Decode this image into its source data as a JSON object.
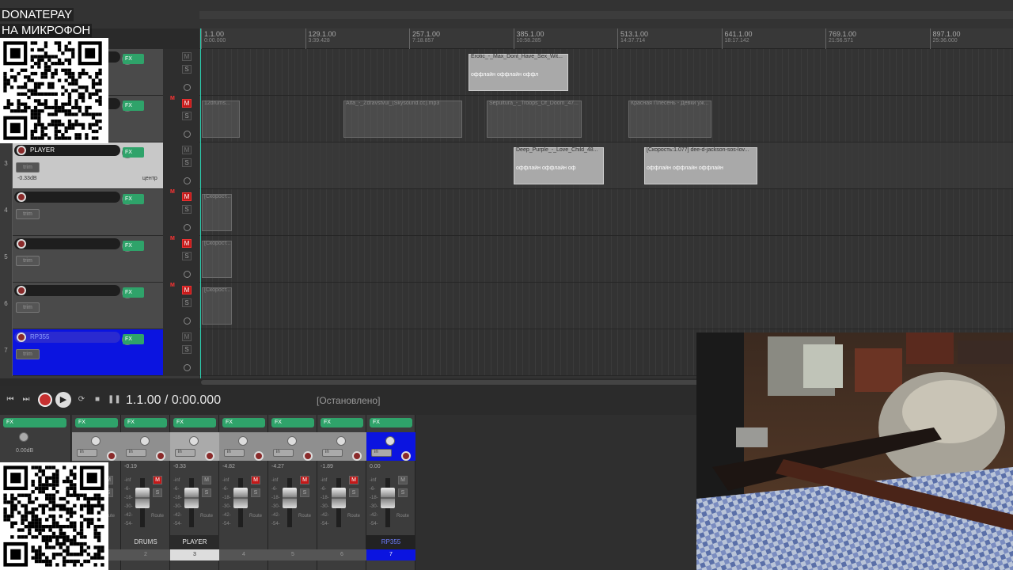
{
  "overlay": {
    "donate_label": "DONATEPAY",
    "mic_label": "НА МИКРОФОН"
  },
  "ruler": {
    "ticks": [
      {
        "bar": "1.1.00",
        "time": "0:00.000"
      },
      {
        "bar": "129.1.00",
        "time": "3:39.428"
      },
      {
        "bar": "257.1.00",
        "time": "7:18.857"
      },
      {
        "bar": "385.1.00",
        "time": "10:58.285"
      },
      {
        "bar": "513.1.00",
        "time": "14:37.714"
      },
      {
        "bar": "641.1.00",
        "time": "18:17.142"
      },
      {
        "bar": "769.1.00",
        "time": "21:56.571"
      },
      {
        "bar": "897.1.00",
        "time": "25:36.000"
      }
    ]
  },
  "tracks": [
    {
      "num": "",
      "name": "",
      "volume": "",
      "pan": "",
      "muted": false
    },
    {
      "num": "",
      "name": "",
      "volume": "",
      "pan": "",
      "muted": true
    },
    {
      "num": "3",
      "name": "PLAYER",
      "volume": "-0.33dB",
      "pan": "центр",
      "muted": false
    },
    {
      "num": "4",
      "name": "",
      "volume": "",
      "pan": "",
      "muted": true
    },
    {
      "num": "5",
      "name": "",
      "volume": "",
      "pan": "",
      "muted": true
    },
    {
      "num": "6",
      "name": "",
      "volume": "",
      "pan": "",
      "muted": true
    },
    {
      "num": "7",
      "name": "RP355",
      "volume": "",
      "pan": "",
      "muted": false
    }
  ],
  "track_labels": {
    "fx": "FX",
    "trim": "trim",
    "mute": "M",
    "solo": "S"
  },
  "items": {
    "t1": [
      {
        "title": "Erotic_-_Max_Dont_Have_Sex_Wit...",
        "wave": "оффлайн   оффлайн   оффл"
      }
    ],
    "t2": [
      {
        "title": "12drums...",
        "wave": ""
      },
      {
        "title": "Alfa_-_Zdravstvui_(Skysound.cc).mp3",
        "wave": ""
      },
      {
        "title": "Sepultura_-_Troops_Of_Doom_47...",
        "wave": ""
      },
      {
        "title": "Красная Плесень - Девки уж...",
        "wave": ""
      }
    ],
    "t3": [
      {
        "title": "Deep_Purple_-_Love_Child_48...",
        "wave": "оффлайн   оффлайн   оф"
      },
      {
        "title": "[Скорость:1.077] dee-d-jackson-sos-lov...",
        "wave": "оффлайн   оффлайн   оффлайн"
      }
    ],
    "t4": [
      {
        "title": "[Скорост...",
        "wave": ""
      }
    ],
    "t5": [
      {
        "title": "[Скорост...",
        "wave": ""
      }
    ],
    "t6": [
      {
        "title": "[Скорост...",
        "wave": ""
      }
    ]
  },
  "transport": {
    "position": "1.1.00 / 0:00.000",
    "status": "[Остановлено]"
  },
  "mixer": {
    "master": {
      "db": "0.00dB"
    },
    "strips": [
      {
        "name": "",
        "num": "1",
        "db": "-0.19",
        "muted": false
      },
      {
        "name": "DRUMS",
        "num": "2",
        "db": "-0.19",
        "muted": true
      },
      {
        "name": "PLAYER",
        "num": "3",
        "db": "-0.33",
        "muted": false
      },
      {
        "name": "",
        "num": "4",
        "db": "-4.82",
        "muted": true
      },
      {
        "name": "",
        "num": "5",
        "db": "-4.27",
        "muted": true
      },
      {
        "name": "",
        "num": "6",
        "db": "-1.89",
        "muted": true
      },
      {
        "name": "RP355",
        "num": "7",
        "db": "0.00",
        "muted": false
      }
    ],
    "labels": {
      "fx": "FX",
      "in": "in",
      "route": "Route",
      "mute": "M",
      "solo": "S"
    },
    "scale": [
      "-inf",
      "-6-",
      "-18-",
      "-30-",
      "-42-",
      "-54-"
    ]
  },
  "colors": {
    "selected_track": "#0b14e0",
    "fx_green": "#2fa36a",
    "mute_red": "#c41818",
    "cursor": "#2bd0b0"
  }
}
